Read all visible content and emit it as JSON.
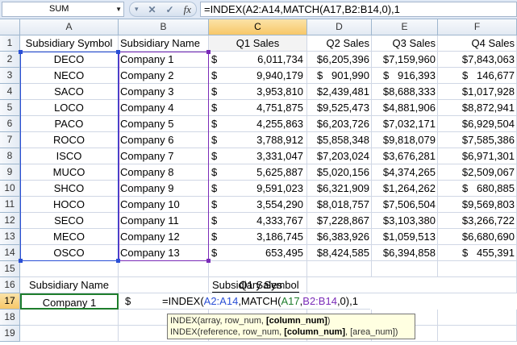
{
  "name_box": "SUM",
  "formula": "=INDEX(A2:A14,MATCH(A17,B2:B14,0),1",
  "columns": [
    "A",
    "B",
    "C",
    "D",
    "E",
    "F"
  ],
  "rows": [
    "1",
    "2",
    "3",
    "4",
    "5",
    "6",
    "7",
    "8",
    "9",
    "10",
    "11",
    "12",
    "13",
    "14",
    "15",
    "16",
    "17",
    "18",
    "19"
  ],
  "headers": [
    "Subsidiary Symbol",
    "Subsidiary Name",
    "Q1 Sales",
    "Q2 Sales",
    "Q3 Sales",
    "Q4 Sales"
  ],
  "data": [
    [
      "DECO",
      "Company 1",
      "6,011,734",
      "$6,205,396",
      "$7,159,960",
      "$7,843,063"
    ],
    [
      "NECO",
      "Company 2",
      "9,940,179",
      "$   901,990",
      "$   916,393",
      "$   146,677"
    ],
    [
      "SACO",
      "Company 3",
      "3,953,810",
      "$2,439,481",
      "$8,688,333",
      "$1,017,928"
    ],
    [
      "LOCO",
      "Company 4",
      "4,751,875",
      "$9,525,473",
      "$4,881,906",
      "$8,872,941"
    ],
    [
      "PACO",
      "Company 5",
      "4,255,863",
      "$6,203,726",
      "$7,032,171",
      "$6,929,504"
    ],
    [
      "ROCO",
      "Company 6",
      "3,788,912",
      "$5,858,348",
      "$9,818,079",
      "$7,585,386"
    ],
    [
      "ISCO",
      "Company 7",
      "3,331,047",
      "$7,203,024",
      "$3,676,281",
      "$6,971,301"
    ],
    [
      "MUCO",
      "Company 8",
      "5,625,887",
      "$5,020,156",
      "$4,374,265",
      "$2,509,067"
    ],
    [
      "SHCO",
      "Company 9",
      "9,591,023",
      "$6,321,909",
      "$1,264,262",
      "$   680,885"
    ],
    [
      "HOCO",
      "Company 10",
      "3,554,290",
      "$8,018,757",
      "$7,506,504",
      "$9,569,803"
    ],
    [
      "SECO",
      "Company 11",
      "4,333,767",
      "$7,228,867",
      "$3,103,380",
      "$3,266,722"
    ],
    [
      "MECO",
      "Company 12",
      "3,186,745",
      "$6,383,926",
      "$1,059,513",
      "$6,680,690"
    ],
    [
      "OSCO",
      "Company 13",
      "653,495",
      "$8,424,585",
      "$6,394,858",
      "$   455,391"
    ]
  ],
  "dollar_sign": "$",
  "row16": {
    "a": "Subsidiary Name",
    "c": "Q1 Sales",
    "d": "Subsidiary Symbol"
  },
  "row17": {
    "a": "Company 1",
    "b": "$",
    "c_formula": "=INDEX(A2:A14,MATCH(A17,B2:B14,0),1"
  },
  "tooltip": {
    "line1_prefix": "INDEX(array, row_num, ",
    "line1_bold": "[column_num]",
    "line1_suffix": ")",
    "line2_prefix": "INDEX(reference, row_num, ",
    "line2_bold": "[column_num]",
    "line2_suffix": ", [area_num])"
  },
  "colors": {
    "range_a": "#2a4fd6",
    "range_b": "#7a2bb8",
    "header_bg": "#dfe8f5",
    "active_header": "#f7c768",
    "cell_selected": "#1e7d2c"
  }
}
